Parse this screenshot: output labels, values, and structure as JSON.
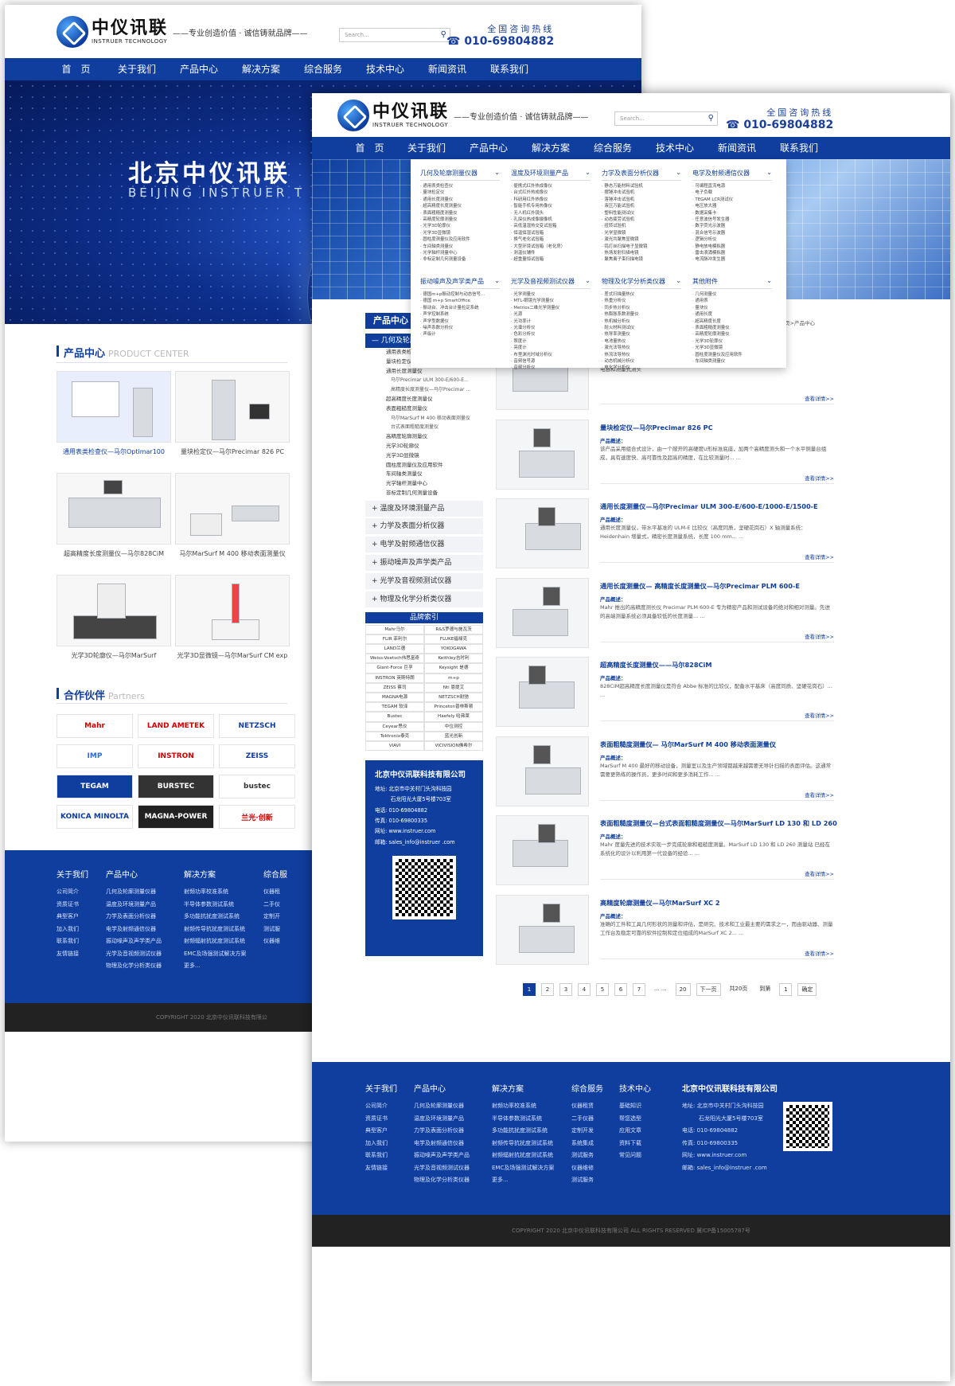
{
  "brand": {
    "cn": "中仪讯联",
    "en": "INSTRUER TECHNOLOGY",
    "slogan": "——专业创造价值 · 诚信铸就品牌——"
  },
  "search_placeholder": "Search...",
  "hotline": {
    "label": "全国咨询热线",
    "number": "010-69804882"
  },
  "nav": [
    "首　页",
    "关于我们",
    "产品中心",
    "解决方案",
    "综合服务",
    "技术中心",
    "新闻资讯",
    "联系我们"
  ],
  "home": {
    "banner_cn": "北京中仪讯联",
    "banner_en": "BEIJING INSTRUER T",
    "product_center": {
      "cn": "产品中心",
      "en": "PRODUCT CENTER"
    },
    "products": [
      "通用表类检查仪—马尔Optimar100",
      "量块检定仪—马尔Precimar 826 PC",
      "超高精度长度测量仪—马尔828CiM",
      "马尔MarSurf M 400 移动表面测量仪",
      "光学3D轮廓仪—马尔MarSurf",
      "光学3D显微镜—马尔MarSurf CM exp"
    ],
    "partners_title": {
      "cn": "合作伙伴",
      "en": "Partners"
    },
    "partners": [
      "Mahr",
      "LAND AMETEK",
      "NETZSCH",
      "IMP",
      "INSTRON",
      "ZEISS",
      "TEGAM",
      "BURSTEC",
      "bustec",
      "KONICA MINOLTA",
      "MAGNA-POWER",
      "兰光·创新"
    ],
    "footer_cols": [
      {
        "h": "关于我们",
        "items": [
          "公司简介",
          "资质证书",
          "典型客户",
          "加入我们",
          "联系我们",
          "友情链接"
        ]
      },
      {
        "h": "产品中心",
        "items": [
          "几何及轮廓测量仪器",
          "温度及环境测量产品",
          "力学及表面分析仪器",
          "电学及射频通信仪器",
          "振动噪声及声学类产品",
          "光学及音视频测试仪器",
          "物理及化学分析类仪器"
        ]
      },
      {
        "h": "解决方案",
        "items": [
          "射频功率校准系统",
          "半导体参数测试系统",
          "多功能抗扰度测试系统",
          "射频传导抗扰度测试系统",
          "射频辐射抗扰度测试系统",
          "EMC及场强测试解决方案",
          "更多..."
        ]
      },
      {
        "h": "综合服",
        "items": [
          "仪器租",
          "二手仪",
          "定制开",
          "测试服",
          "仪器维"
        ]
      }
    ],
    "copyright": "COPYRIGHT 2020    北京中仪讯联科技有限公"
  },
  "mega": {
    "cols": [
      {
        "h": "几何及轮廓测量仪器",
        "items": [
          "通用表类检查仪",
          "量块检定仪",
          "通用长度测量仪",
          "超高精度长度测量仪",
          "表面粗糙度测量仪",
          "高精度轮廓测量仪",
          "光学3D轮廓仪",
          "光学3D显微镜",
          "圆柱度测量仪及应用软件",
          "车间轴类测量仪",
          "光学轴杆测量中心",
          "非标定制几何测量设备"
        ]
      },
      {
        "h": "温度及环境测量产品",
        "items": [
          "便携式红外热成像仪",
          "台式红外热成像仪",
          "科研用红外热像仪",
          "智能手机专用热像仪",
          "无人机红外镜头",
          "孔探仪热成像摄像机",
          "高低温湿热交变试验箱",
          "恒温恒湿试验箱",
          "换气老化试验箱",
          "大型环境试验箱（老化房）",
          "测温仪辅件",
          "超重量恒试验箱"
        ]
      },
      {
        "h": "力学及表面分析仪器",
        "items": [
          "静态万能材料试验机",
          "摆锤冲击试验机",
          "落锤冲击试验机",
          "液压万能试验机",
          "塑料性能测试仪",
          "动态疲劳试验机",
          "扭转试验机",
          "光学显微镜",
          "激光共聚焦显微镜",
          "钨灯丝扫描电子显微镜",
          "热场发射扫描电镜",
          "聚焦离子束扫描电镜"
        ]
      },
      {
        "h": "电学及射频通信仪器",
        "items": [
          "可编程直流电源",
          "电子负载",
          "TEGAM LCR测试仪",
          "电压放大器",
          "数据采集卡",
          "任意波信号发生器",
          "数字荧光示波器",
          "混合信号示波器",
          "逻辑分析仪",
          "静电放电模拟器",
          "雷击浪涌模拟器",
          "电流脉冲发生器"
        ]
      },
      {
        "h": "振动噪声及声学类产品",
        "items": [
          "德国m+p振动控制与动态信号...",
          "德国 m+p SmartOffice",
          "振动台、冲击台计量检定系统",
          "声学控制系统",
          "声学型数据仪",
          "噪声系数分析仪",
          "声级计"
        ]
      },
      {
        "h": "光学及音视频测试仪器",
        "items": [
          "光学测量仪",
          "MTL-眼镜光学测量仪",
          "Metrios二维光学测量仪",
          "光源",
          "光功率计",
          "光谱分析仪",
          "色彩分析仪",
          "照度计",
          "亮度计",
          "布里渊光时域分析仪",
          "音频信号源",
          "音频分析仪"
        ]
      },
      {
        "h": "物理及化学分析类仪器",
        "items": [
          "差式扫描量热仪",
          "热重分析仪",
          "同步热分析仪",
          "热膨胀系数测量仪",
          "热机械分析仪",
          "耐火材料测试仪",
          "热导率测量仪",
          "电池量热仪",
          "激光法导热仪",
          "热流法导热仪",
          "动态机械分析仪",
          "电化学分析仪"
        ]
      },
      {
        "h": "其他附件",
        "items": [
          "几何测量仪",
          "通用表",
          "量块仪",
          "通用长度",
          "超高精度长度",
          "表面粗糙度测量仪",
          "高精度轮廓测量仪",
          "光学3D轮廓仪",
          "光学3D显微镜",
          "圆柱度测量仪及应用软件",
          "车间轴类测量仪"
        ]
      }
    ]
  },
  "list": {
    "sidebar_title": "产品中心",
    "active_cat": "几何及轮廓测量仪器",
    "sub_items": [
      {
        "t": "通用表类检查仪",
        "d": 1
      },
      {
        "t": "量块检定仪",
        "d": 1
      },
      {
        "t": "通用长度测量仪",
        "d": 1
      },
      {
        "t": "马尔Precimar ULM 300-E/600-E...",
        "d": 2
      },
      {
        "t": "高精度长度测量仪—马尔Precimar ...",
        "d": 2
      },
      {
        "t": "超高精度长度测量仪",
        "d": 1
      },
      {
        "t": "表面粗糙度测量仪",
        "d": 1
      },
      {
        "t": "马尔MarSurf M 400 移动表面测量仪",
        "d": 2
      },
      {
        "t": "台式表面粗糙度测量仪",
        "d": 2
      },
      {
        "t": "高精度轮廓测量仪",
        "d": 1
      },
      {
        "t": "光学3D轮廓仪",
        "d": 1
      },
      {
        "t": "光学3D显微镜",
        "d": 1
      },
      {
        "t": "圆柱度测量仪及应用软件",
        "d": 1
      },
      {
        "t": "车间轴类测量仪",
        "d": 1
      },
      {
        "t": "光学轴杆测量中心",
        "d": 1
      },
      {
        "t": "非标定制几何测量设备",
        "d": 1
      }
    ],
    "other_cats": [
      "温度及环境测量产品",
      "力学及表面分析仪器",
      "电学及射频通信仪器",
      "振动噪声及声学类产品",
      "光学及音视频测试仪器",
      "物理及化学分析类仪器"
    ],
    "brand_index_title": "品牌索引",
    "brands": [
      "Mahr马尔",
      "R&S罗德与施瓦茨",
      "FLIR 菲利尔",
      "FLUKE福禄克",
      "LAND兰德",
      "YOKOGAWA",
      "Weiss-Voetsch伟思富奇",
      "Keithley吉时利",
      "Giant-Force 巨孚",
      "Keysight 是德",
      "INSTRON 英斯特朗",
      "m+p",
      "ZEISS 蔡司",
      "Nti 恩提艾",
      "MAGNA电源",
      "NETZSCH耐驰",
      "TEGAM 软泽",
      "Princeton普林斯顿",
      "Bustec",
      "Haefely 哈弗莱",
      "Ceyear思仪",
      "中位测控",
      "Tektronix泰克",
      "蓝光创新",
      "VIAVI",
      "VICIVISION佛希尔"
    ],
    "contact": {
      "h": "北京中仪讯联科技有限公司",
      "lines": [
        "地址: 北京市中关村门头沟科技园",
        "　　　石龙阳光大厦5号楼703室",
        "电话: 010-69804882",
        "传真: 010-69800335",
        "网址: www.instruer.com",
        "邮箱: sales_info@instruer .com"
      ]
    },
    "crumb": "当前位置：首页>产品中心",
    "items": [
      {
        "title": "通用表类检查仪—马尔Optimar100",
        "sub": "产品概述：",
        "desc": "电感和测量式测头",
        "more": "查看详情>>"
      },
      {
        "title": "量块检定仪—马尔Precimar 826 PC",
        "sub": "产品概述：",
        "desc": "该产品采用组合式设计，由一个敞开的高硬度U形标准底座，加两个高精度测头和一个水平侧量台组成，具有速度快、高可靠性及超高的精度，在比较测量时... ...",
        "more": "查看详情>>"
      },
      {
        "title": "通用长度测量仪—马尔Precimar ULM 300-E/600-E/1000-E/1500-E",
        "sub": "产品概述：",
        "desc": "通用长度测量仪，带水平基准的 ULM-E 比较仪（高度同质，坚硬花岗石）X 轴测量系统：Heidenhain 增量式，精密长度测量系统，长度 100 mm... ...",
        "more": "查看详情>>"
      },
      {
        "title": "通用长度测量仪— 高精度长度测量仪—马尔Precimar PLM 600-E",
        "sub": "产品概述：",
        "desc": "Mahr 推出的高精度测长仪 Precimar PLM 600-E 专为精密产品和测试设备的绝对和相对测量。先进的高端测量系统必须具备较低的长度测量... ...",
        "more": "查看详情>>"
      },
      {
        "title": "超高精度长度测量仪——马尔828CiM",
        "sub": "产品概述：",
        "desc": "828CiM超高精度长度测量仪是符合 Abbe 标准的比较仪，配备水平基床（高度同质、坚硬花岗石）... ...",
        "more": "查看详情>>"
      },
      {
        "title": "表面粗糙度测量仪— 马尔MarSurf M 400 移动表面测量仪",
        "sub": "产品概述：",
        "desc": "MarSurf M 400 最好的移动设备，测量室以及生产领域都越来越需要无导针扫描的表面评估。这通常需要更熟练的操作员，更多时间和更多消耗工作... ...",
        "more": "查看详情>>"
      },
      {
        "title": "表面粗糙度测量仪—台式表面粗糙度测量仪—马尔MarSurf LD 130 和 LD 260",
        "sub": "产品概述：",
        "desc": "Mahr 度量先进的技术实现一步完成轮廓和粗糙度测量。MarSurf LD 130 和 LD 260 测量站 已经在系统化的设计以利用第一代设备的经验... ...",
        "more": "查看详情>>"
      },
      {
        "title": "高精度轮廓测量仪—马尔MarSurf XC 2",
        "sub": "产品概述：",
        "desc": "准确的工件和工具几何形状的测量和评估，是研究、技术和工业最主要的需求之一，而由驱动器、测量工作台及稳定可靠的软件控制和定位组成的MarSurf XC 2... ...",
        "more": "查看详情>>"
      }
    ],
    "pager": [
      "1",
      "2",
      "3",
      "4",
      "5",
      "6",
      "7",
      "... ...",
      "20",
      "下一页",
      "共20页",
      "到第",
      "1",
      "确定"
    ],
    "footer_cols": [
      {
        "h": "关于我们",
        "items": [
          "公司简介",
          "资质证书",
          "典型客户",
          "加入我们",
          "联系我们",
          "友情链接"
        ]
      },
      {
        "h": "产品中心",
        "items": [
          "几何及轮廓测量仪器",
          "温度及环境测量产品",
          "力学及表面分析仪器",
          "电学及射频通信仪器",
          "振动噪声及声学类产品",
          "光学及音视频测试仪器",
          "物理及化学分析类仪器"
        ]
      },
      {
        "h": "解决方案",
        "items": [
          "射频功率校准系统",
          "半导体参数测试系统",
          "多功能抗扰度测试系统",
          "射频传导抗扰度测试系统",
          "射频辐射抗扰度测试系统",
          "EMC及场强测试解决方案",
          "更多..."
        ]
      },
      {
        "h": "综合服务",
        "items": [
          "仪器租赁",
          "二手仪器",
          "定制开发",
          "系统集成",
          "测试服务",
          "仪器维修",
          "测试服务"
        ]
      },
      {
        "h": "技术中心",
        "items": [
          "基础知识",
          "帮您选型",
          "应用文章",
          "资料下载",
          "常见问题"
        ]
      }
    ],
    "footer_company": {
      "h": "北京中仪讯联科技有限公司",
      "lines": [
        "地址: 北京市中关村门头沟科技园",
        "　　　石龙阳光大厦5号楼703室",
        "电话: 010-69804882",
        "传真: 010-69800335",
        "网址: www.instruer.com",
        "邮箱: sales_info@instruer .com"
      ]
    },
    "copyright": "COPYRIGHT 2020    北京中仪讯联科技有限公司    ALL RIGHTS RESERVED    冀ICP备15005787号"
  }
}
